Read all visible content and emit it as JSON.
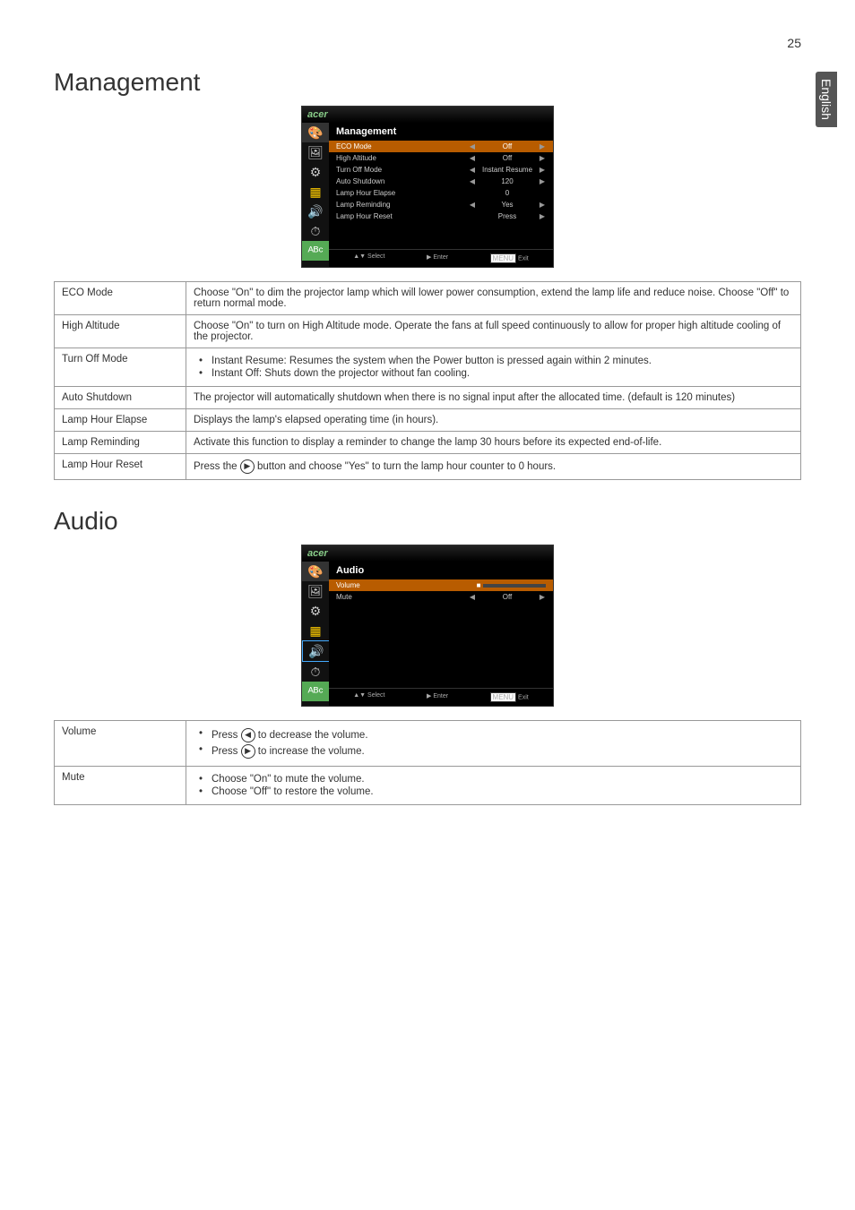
{
  "page_number": "25",
  "side_tab": "English",
  "sections": {
    "management": {
      "heading": "Management",
      "osd": {
        "logo": "acer",
        "title": "Management",
        "rows": [
          {
            "label": "ECO Mode",
            "value": "Off",
            "selected": true
          },
          {
            "label": "High Altitude",
            "value": "Off"
          },
          {
            "label": "Turn Off Mode",
            "value": "Instant Resume"
          },
          {
            "label": "Auto Shutdown",
            "value": "120"
          },
          {
            "label": "Lamp Hour Elapse",
            "value": "0"
          },
          {
            "label": "Lamp Reminding",
            "value": "Yes"
          },
          {
            "label": "Lamp Hour Reset",
            "value": "Press"
          }
        ],
        "footer": {
          "select": "▲▼ Select",
          "enter": "▶ Enter",
          "exit": "MENU Exit"
        }
      },
      "table": [
        {
          "name": "ECO Mode",
          "desc": "Choose \"On\" to dim the projector lamp which will lower power consumption, extend the lamp life and reduce noise.  Choose \"Off\" to return normal mode."
        },
        {
          "name": "High Altitude",
          "desc": "Choose \"On\" to turn on High Altitude mode. Operate the fans at full speed continuously to allow for proper high altitude cooling of the projector."
        },
        {
          "name": "Turn Off Mode",
          "bullets": [
            "Instant Resume: Resumes the system when the Power button is pressed again within 2 minutes.",
            "Instant Off: Shuts down the projector without fan cooling."
          ]
        },
        {
          "name": "Auto Shutdown",
          "desc": "The projector will automatically shutdown when there is no signal input after the allocated time. (default is 120 minutes)"
        },
        {
          "name": "Lamp Hour Elapse",
          "desc": "Displays the lamp's elapsed operating time (in hours)."
        },
        {
          "name": "Lamp Reminding",
          "desc": "Activate this function to display a reminder to change the lamp 30 hours before its expected end-of-life."
        },
        {
          "name": "Lamp Hour Reset",
          "desc_pre": "Press the ",
          "btn": "▶",
          "desc_post": " button and choose \"Yes\" to turn the lamp hour counter to 0 hours."
        }
      ]
    },
    "audio": {
      "heading": "Audio",
      "osd": {
        "logo": "acer",
        "title": "Audio",
        "rows": [
          {
            "label": "Volume",
            "slider": true,
            "selected": true
          },
          {
            "label": "Mute",
            "value": "Off"
          }
        ],
        "footer": {
          "select": "▲▼ Select",
          "enter": "▶ Enter",
          "exit": "MENU Exit"
        }
      },
      "table": [
        {
          "name": "Volume",
          "bullets_btn": [
            {
              "pre": "Press ",
              "btn": "◀",
              "post": " to decrease the volume."
            },
            {
              "pre": "Press ",
              "btn": "▶",
              "post": " to increase the volume."
            }
          ]
        },
        {
          "name": "Mute",
          "bullets": [
            "Choose \"On\" to mute the volume.",
            "Choose \"Off\" to restore the volume."
          ]
        }
      ]
    }
  }
}
